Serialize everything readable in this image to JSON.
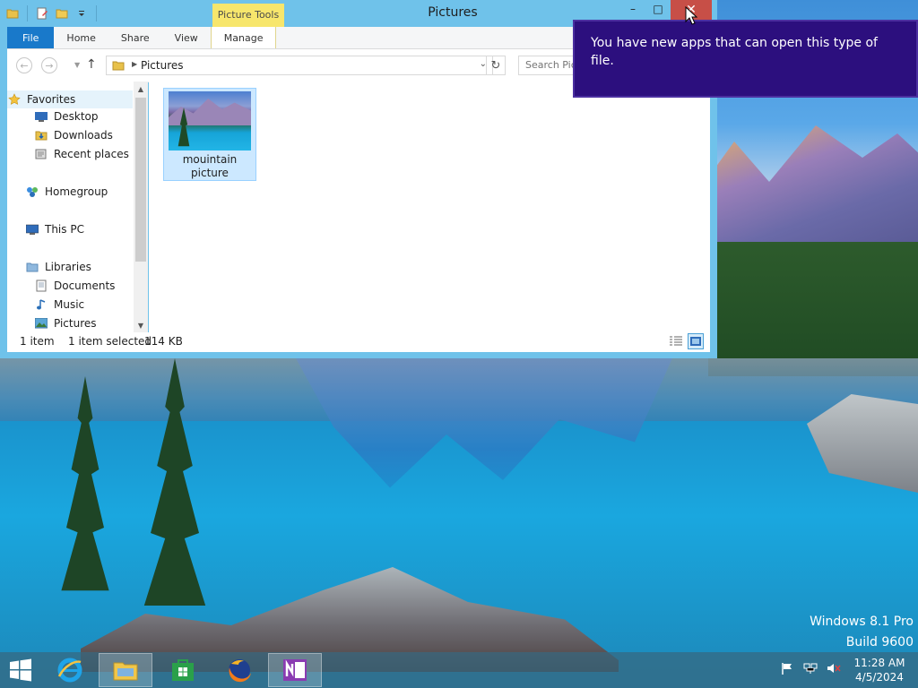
{
  "window": {
    "title": "Pictures",
    "contextual_tab_group": "Picture Tools",
    "controls": {
      "minimize": "–",
      "maximize": "□",
      "close": "✕"
    }
  },
  "ribbon": {
    "tabs": [
      "File",
      "Home",
      "Share",
      "View",
      "Manage"
    ]
  },
  "address": {
    "path": "Pictures",
    "search_placeholder": "Search Pictures"
  },
  "navigation": {
    "favorites": {
      "label": "Favorites",
      "items": [
        "Desktop",
        "Downloads",
        "Recent places"
      ]
    },
    "homegroup": "Homegroup",
    "this_pc": "This PC",
    "libraries": {
      "label": "Libraries",
      "items": [
        "Documents",
        "Music",
        "Pictures"
      ]
    }
  },
  "files": [
    {
      "name": "mouintain picture",
      "selected": true
    }
  ],
  "status": {
    "count": "1 item",
    "selection": "1 item selected",
    "size": "114 KB"
  },
  "notification": {
    "text": "You have new apps that can open this type of file."
  },
  "watermark": {
    "edition": "Windows 8.1 Pro",
    "build": "Build 9600"
  },
  "taskbar": {
    "apps": [
      "internet-explorer-icon",
      "file-explorer-icon",
      "store-icon",
      "firefox-icon",
      "onenote-icon"
    ],
    "time": "11:28 AM",
    "date": "4/5/2024"
  },
  "colors": {
    "accent": "#1979ca",
    "toast_bg": "#2c0f7e",
    "picture_tools": "#f7e66c",
    "close_red": "#c74f47",
    "window_frame": "#6fc2ea"
  }
}
